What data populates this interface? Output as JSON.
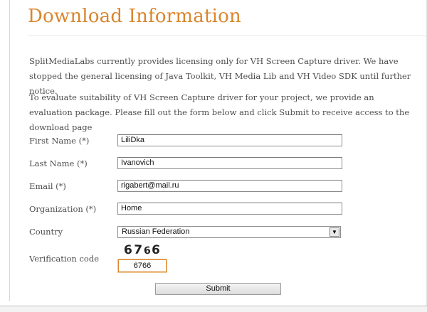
{
  "page": {
    "title": "Download Information",
    "paragraph1": "SplitMediaLabs currently provides licensing only for VH Screen Capture driver. We have stopped the general licensing of Java Toolkit, VH Media Lib and VH Video SDK until further notice.",
    "paragraph2": "To evaluate suitability of VH Screen Capture driver for your project, we provide an evaluation package. Please fill out the form below and click Submit to receive access to the download page"
  },
  "form": {
    "first_name": {
      "label": "First Name (*)",
      "value": "LiliDka"
    },
    "last_name": {
      "label": "Last Name (*)",
      "value": "Ivanovich"
    },
    "email": {
      "label": "Email (*)",
      "value": "rigabert@mail.ru"
    },
    "organization": {
      "label": "Organization (*)",
      "value": "Home"
    },
    "country": {
      "label": "Country",
      "value": "Russian Federation"
    },
    "verification": {
      "label": "Verification code",
      "captcha_chars": [
        "6",
        "7",
        "6",
        "6"
      ],
      "value": "6766"
    },
    "submit_label": "Submit"
  },
  "colors": {
    "accent": "#d9862d",
    "text": "#4d4d4d"
  }
}
